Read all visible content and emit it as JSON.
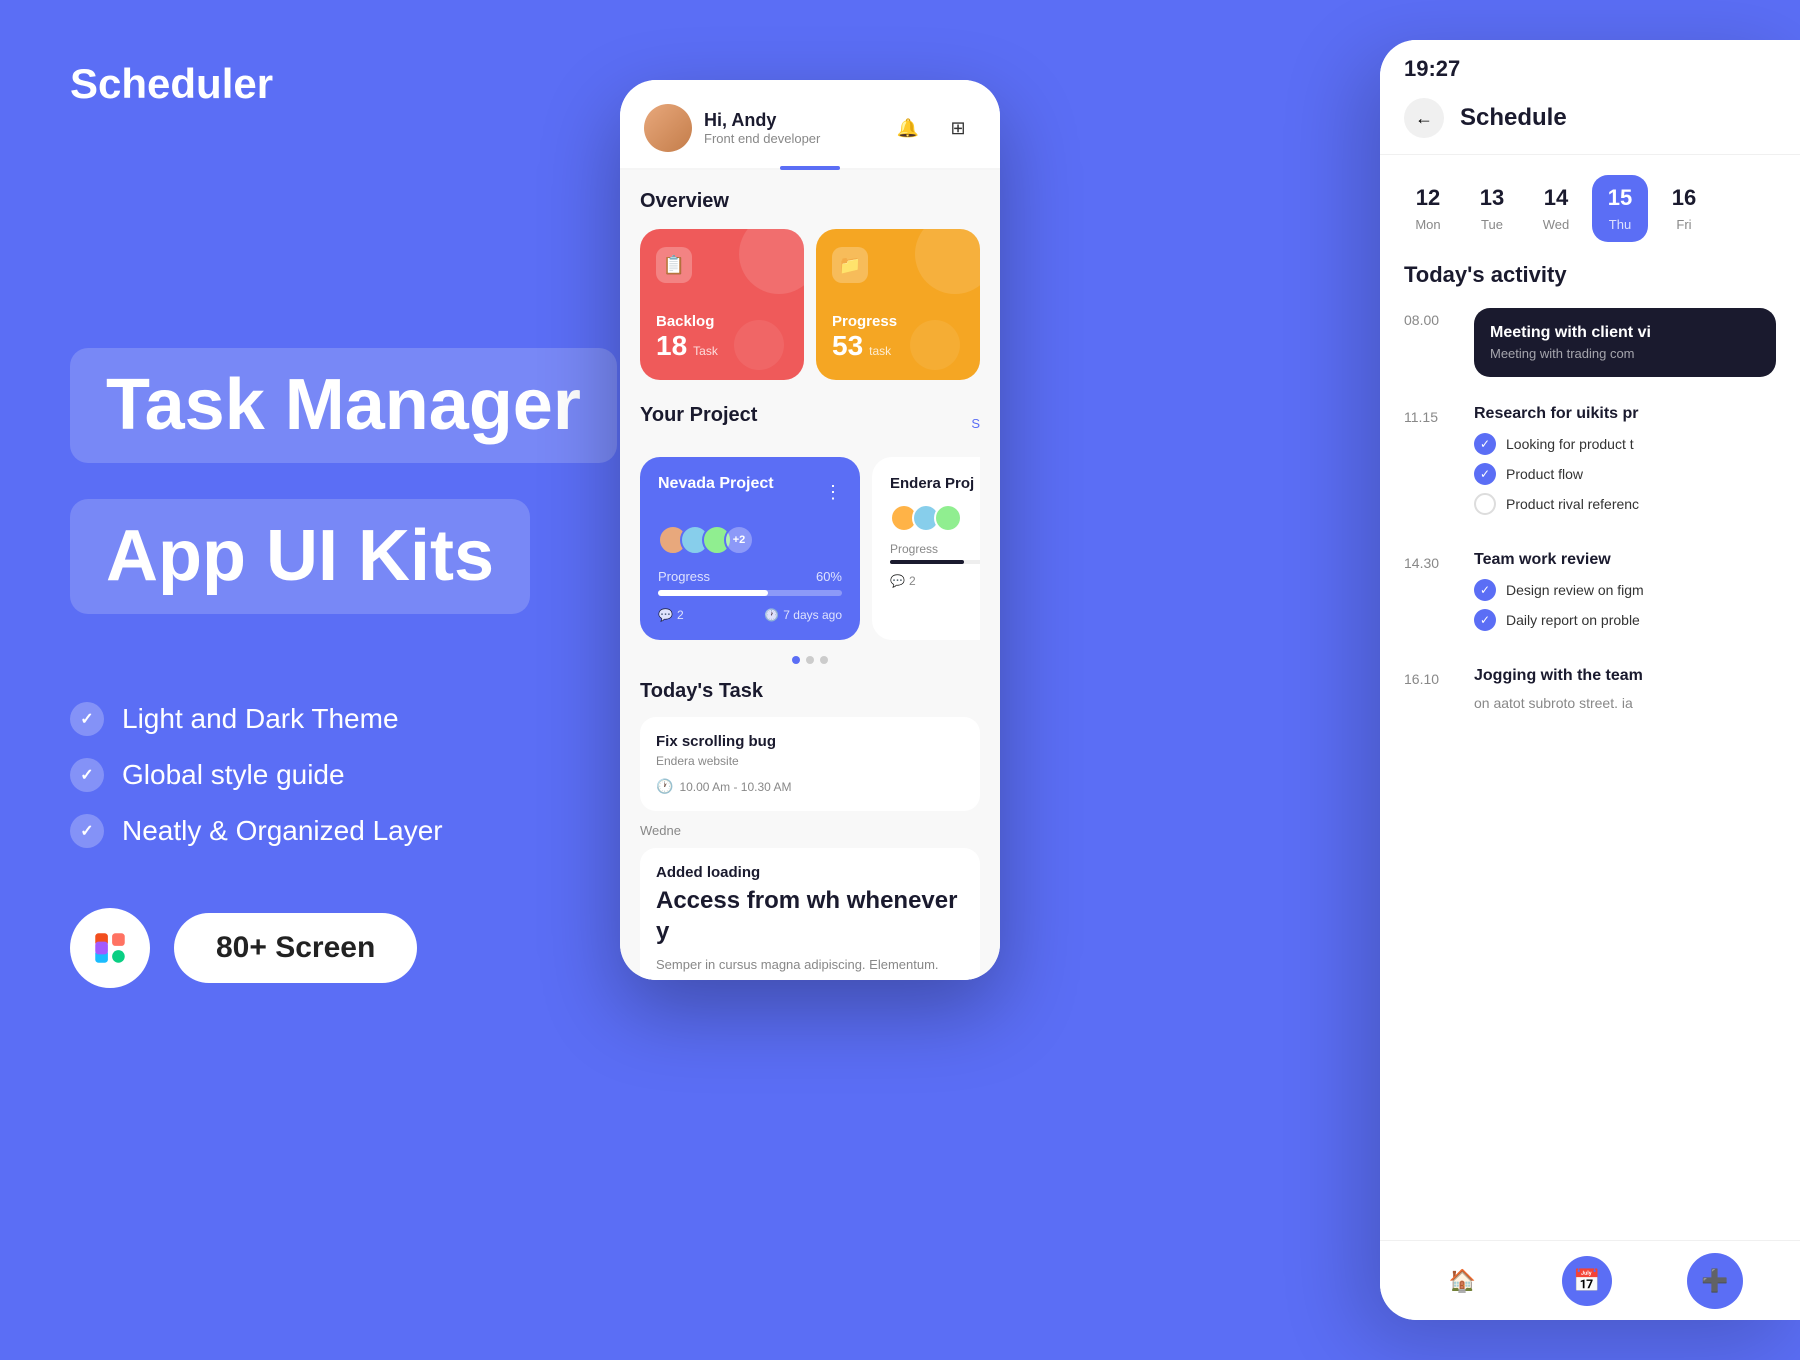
{
  "brand": {
    "title": "Scheduler"
  },
  "hero": {
    "line1": "Task Manager",
    "line2": "App UI Kits"
  },
  "features": [
    {
      "label": "Light and Dark Theme"
    },
    {
      "label": "Global style guide"
    },
    {
      "label": "Neatly & Organized Layer"
    }
  ],
  "badge": {
    "screens": "80+ Screen"
  },
  "phone1": {
    "greeting": "Hi, Andy",
    "role": "Front end developer",
    "overview_title": "Overview",
    "cards": [
      {
        "label": "Backlog",
        "count": "18",
        "unit": "Task",
        "color": "red"
      },
      {
        "label": "Progress",
        "count": "53",
        "unit": "task",
        "color": "orange"
      }
    ],
    "projects_title": "Your Project",
    "see_all": "S",
    "nevada_title": "Nevada Project",
    "nevada_progress": "60%",
    "nevada_progress_val": "Progress",
    "nevada_days": "7 days ago",
    "nevada_comments": "2",
    "endera_title": "Endera Proj",
    "endera_progress": "Progress",
    "endera_comments": "2",
    "today_task": "Today's Task",
    "task1_name": "Fix scrolling bug",
    "task1_project": "Endera website",
    "task1_time": "10.00 Am - 10.30 AM",
    "task2_name": "Added loading",
    "wed_label": "Wedne",
    "access_heading": "Access from wh whenever y",
    "access_desc": "Semper in cursus magna adipiscing. Elementum. sem ."
  },
  "phone2": {
    "time": "19:27",
    "title": "Schedule",
    "back_label": "←",
    "calendar": [
      {
        "num": "12",
        "day": "Mon"
      },
      {
        "num": "13",
        "day": "Tue"
      },
      {
        "num": "14",
        "day": "Wed"
      },
      {
        "num": "15",
        "day": "Thu",
        "active": true
      },
      {
        "num": "16",
        "day": "Fri"
      }
    ],
    "activity_title": "Today's activity",
    "events": [
      {
        "time": "08.00",
        "title": "Meeting with client vi",
        "subtitle": "Meeting with trading com",
        "type": "dark"
      },
      {
        "time": "11.15",
        "title": "Research for uikits pr",
        "tasks": [
          {
            "label": "Looking for product t",
            "done": true
          },
          {
            "label": "Product flow",
            "done": true
          },
          {
            "label": "Product rival referenc",
            "done": false
          }
        ]
      },
      {
        "time": "14.30",
        "title": "Team work review",
        "tasks": [
          {
            "label": "Design review on figm",
            "done": true
          },
          {
            "label": "Daily report on proble",
            "done": true
          }
        ]
      },
      {
        "time": "16.10",
        "title": "Jogging with the team",
        "subtitle": "on aatot subroto street. ia"
      }
    ],
    "nav_items": [
      {
        "icon": "🏠",
        "label": "home"
      },
      {
        "icon": "📅",
        "label": "calendar",
        "active": true
      },
      {
        "icon": "➕",
        "label": "add"
      }
    ]
  },
  "colors": {
    "accent": "#5B6EF5",
    "dark": "#1a1a2e",
    "red_card": "#EF5A5A",
    "orange_card": "#F5A623"
  }
}
